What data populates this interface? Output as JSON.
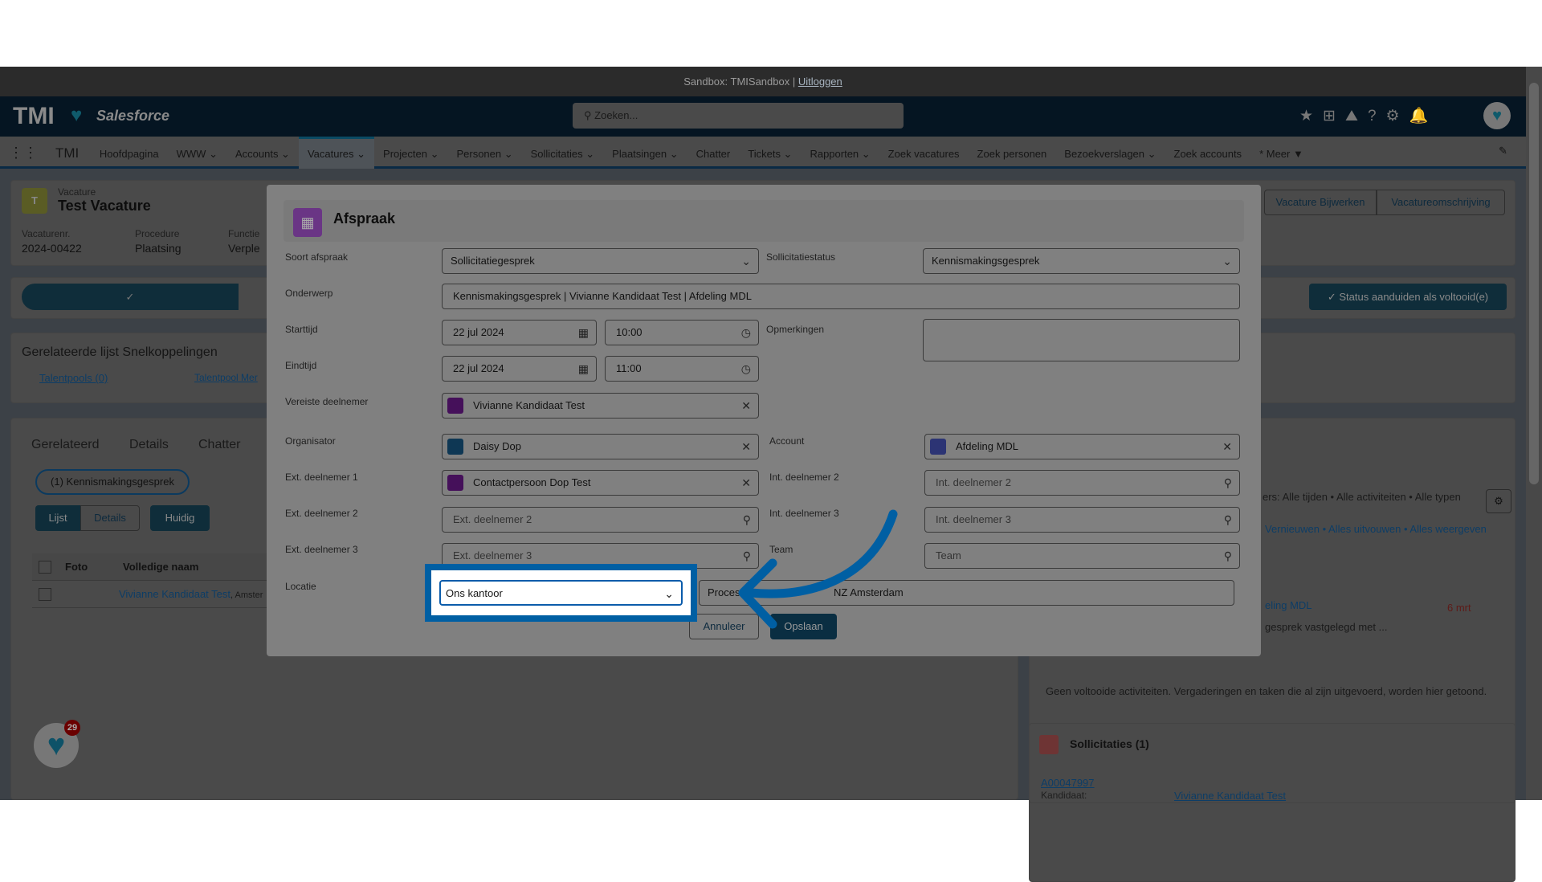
{
  "sandbox": {
    "text": "Sandbox: TMISandbox |",
    "logout": "Uitloggen"
  },
  "header": {
    "logo": "TMI",
    "brand": "Salesforce",
    "search_placeholder": "Zoeken..."
  },
  "nav": {
    "app": "TMI",
    "items": [
      "Hoofdpagina",
      "WWW ⌄",
      "Accounts ⌄",
      "Vacatures ⌄",
      "Projecten ⌄",
      "Personen ⌄",
      "Sollicitaties ⌄",
      "Plaatsingen ⌄",
      "Chatter",
      "Tickets ⌄",
      "Rapporten ⌄",
      "Zoek vacatures",
      "Zoek personen",
      "Bezoekverslagen ⌄",
      "Zoek accounts",
      "* Meer ▼"
    ]
  },
  "record": {
    "type": "Vacature",
    "title": "Test Vacature",
    "fields": [
      {
        "label": "Vacaturenr.",
        "value": "2024-00422"
      },
      {
        "label": "Procedure",
        "value": "Plaatsing"
      },
      {
        "label": "Functie",
        "value": "Verple"
      }
    ],
    "buttons": [
      "Vacature Bijwerken",
      "Vacatureomschrijving"
    ],
    "status_button": "Status aanduiden als voltooid(e)"
  },
  "quicklinks": {
    "title": "Gerelateerde lijst Snelkoppelingen",
    "links": [
      "Talentpools (0)",
      "Talentpool Mer"
    ]
  },
  "tabs": [
    "Gerelateerd",
    "Details",
    "Chatter"
  ],
  "related": {
    "filter": "(1) Kennismakingsgesprek",
    "toggle": [
      "Lijst",
      "Details"
    ],
    "current": "Huidig",
    "columns": [
      "Foto",
      "Volledige naam"
    ],
    "row": {
      "name": "Vivianne Kandidaat Test",
      "extra": ", Amster"
    }
  },
  "activity": {
    "filters": "ers: Alle tijden • Alle activiteiten • Alle typen",
    "links": [
      "Vernieuwen",
      "Alles uitvouwen",
      "Alles weergeven"
    ],
    "item_title": "eling MDL",
    "item_date": "6 mrt",
    "item_desc": "gesprek vastgelegd met ...",
    "empty": "Geen voltooide activiteiten. Vergaderingen en taken die al zijn uitgevoerd, worden hier getoond."
  },
  "applications": {
    "title": "Sollicitaties (1)",
    "id": "A00047997",
    "cand_label": "Kandidaat:",
    "cand": "Vivianne Kandidaat Test"
  },
  "badge": "29",
  "modal": {
    "title": "Afspraak",
    "soort": {
      "label": "Soort afspraak",
      "value": "Sollicitatiegesprek"
    },
    "status": {
      "label": "Sollicitatiestatus",
      "value": "Kennismakingsgesprek"
    },
    "onderwerp": {
      "label": "Onderwerp",
      "value": "Kennismakingsgesprek | Vivianne Kandidaat Test | Afdeling MDL"
    },
    "start": {
      "label": "Starttijd",
      "date": "22 jul 2024",
      "time": "10:00"
    },
    "eind": {
      "label": "Eindtijd",
      "date": "22 jul 2024",
      "time": "11:00"
    },
    "opmerkingen": {
      "label": "Opmerkingen",
      "value": ""
    },
    "vereiste": {
      "label": "Vereiste deelnemer",
      "value": "Vivianne Kandidaat Test"
    },
    "organisator": {
      "label": "Organisator",
      "value": "Daisy Dop"
    },
    "account": {
      "label": "Account",
      "value": "Afdeling MDL"
    },
    "ext1": {
      "label": "Ext. deelnemer 1",
      "value": "Contactpersoon Dop Test"
    },
    "ext2": {
      "label": "Ext. deelnemer 2",
      "placeholder": "Ext. deelnemer 2"
    },
    "ext3": {
      "label": "Ext. deelnemer 3",
      "placeholder": "Ext. deelnemer 3"
    },
    "int2": {
      "label": "Int. deelnemer 2",
      "placeholder": "Int. deelnemer 2"
    },
    "int3": {
      "label": "Int. deelnemer 3",
      "placeholder": "Int. deelnemer 3"
    },
    "team": {
      "label": "Team",
      "placeholder": "Team"
    },
    "locatie": {
      "label": "Locatie",
      "value": "Ons kantoor",
      "address_start": "Process",
      "address_end": "NZ Amsterdam"
    },
    "cancel": "Annuleer",
    "save": "Opslaan"
  },
  "colors": {
    "highlight": "#005fa3",
    "brand": "#032d60",
    "event_icon": "#cb65ff",
    "save": "#0b5cab"
  }
}
